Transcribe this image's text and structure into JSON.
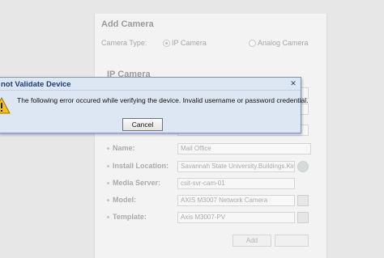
{
  "form": {
    "title": "Add Camera",
    "camera_type_label": "Camera Type:",
    "ip_camera_option": "IP Camera",
    "analog_camera_option": "Analog Camera",
    "section_title": "IP Camera",
    "fields": [
      {
        "label": "Name:",
        "value": "Mail Office"
      },
      {
        "label": "Install Location:",
        "value": "Savannah State University.Buildings.Kin"
      },
      {
        "label": "Media Server:",
        "value": "csit-svr-cam-01"
      },
      {
        "label": "Model:",
        "value": "AXIS M3007 Network Camera"
      },
      {
        "label": "Template:",
        "value": "Axis M3007-PV"
      }
    ],
    "add_label": "Add"
  },
  "dialog": {
    "title": "not Validate Device",
    "close_glyph": "✕",
    "message": "The following error occured while verifying the device. Invalid username or password credential.",
    "cancel_label": "Cancel"
  },
  "colors": {
    "dialog_bg": "#dde7f3",
    "dialog_border": "#7d95b5",
    "dialog_title": "#1d3d72",
    "warning": "#f2c21b"
  }
}
